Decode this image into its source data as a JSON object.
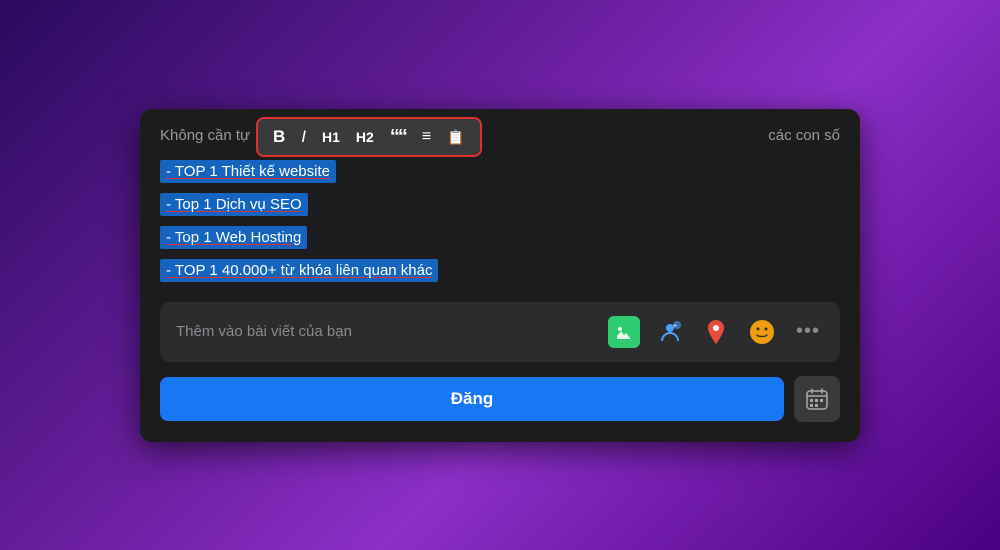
{
  "modal": {
    "hint_text_left": "Không cần tự",
    "hint_text_right": "các con số"
  },
  "toolbar": {
    "bold_label": "B",
    "italic_label": "I",
    "h1_label": "H1",
    "h2_label": "H2",
    "quote_label": "““",
    "list_ul_label": "≡",
    "list_ol_label": "⩳"
  },
  "list_items": [
    "- TOP 1 Thiết kế website",
    "- Top 1 Dịch vụ SEO",
    "- Top 1 Web Hosting",
    "- TOP 1 40.000+  từ khóa liên quan khác"
  ],
  "add_media": {
    "label": "Thêm vào bài viết của bạn",
    "icons": [
      "photo",
      "person",
      "location",
      "emoji",
      "more"
    ]
  },
  "post_button_label": "Đăng",
  "calendar_icon": "📅"
}
